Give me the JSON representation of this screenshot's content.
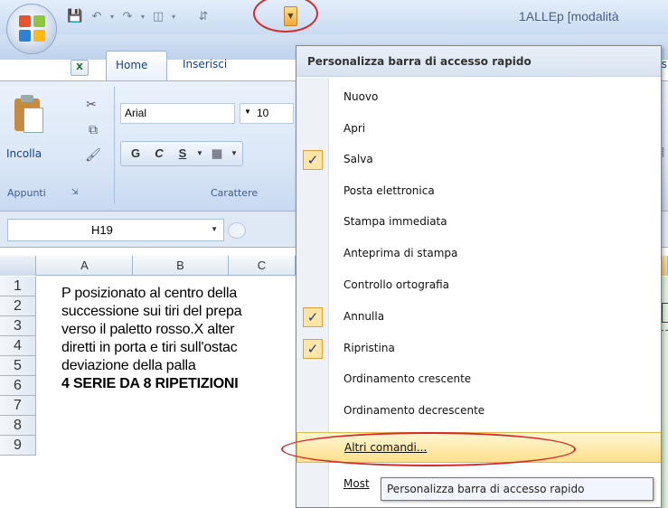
{
  "window": {
    "title": "1ALLEp  [modalità"
  },
  "quick_access": {
    "icons": [
      "save-icon",
      "undo-icon",
      "redo-icon",
      "print-preview-icon",
      "sort-icon",
      "customize-dropdown-icon"
    ]
  },
  "ribbon": {
    "tabs": [
      {
        "label": "Home"
      },
      {
        "label": "Inserisci"
      },
      {
        "label": "Revisi"
      }
    ],
    "clipboard": {
      "paste_label": "Incolla",
      "group_label": "Appunti"
    },
    "font": {
      "name": "Arial",
      "size": "10",
      "bold_label": "G",
      "italic_label": "C",
      "underline_label": "S",
      "group_label": "Carattere"
    }
  },
  "formula_bar": {
    "name_box": "H19"
  },
  "grid": {
    "columns": [
      "A",
      "B",
      "C"
    ],
    "rows": [
      "1",
      "2",
      "3",
      "4",
      "5",
      "6",
      "7",
      "8",
      "9"
    ],
    "cells": [
      "P posizionato al centro della",
      "successione sui tiri del prepa",
      "verso il paletto rosso.X alter",
      "diretti in porta e tiri sull'ostac",
      "deviazione della palla",
      "4 SERIE DA 8 RIPETIZIONI"
    ]
  },
  "menu": {
    "title": "Personalizza barra di accesso rapido",
    "items": [
      {
        "label": "Nuovo",
        "checked": false
      },
      {
        "label": "Apri",
        "checked": false
      },
      {
        "label": "Salva",
        "checked": true
      },
      {
        "label": "Posta elettronica",
        "checked": false
      },
      {
        "label": "Stampa immediata",
        "checked": false
      },
      {
        "label": "Anteprima di stampa",
        "checked": false
      },
      {
        "label": "Controllo ortografia",
        "checked": false
      },
      {
        "label": "Annulla",
        "checked": true
      },
      {
        "label": "Ripristina",
        "checked": true
      },
      {
        "label": "Ordinamento crescente",
        "checked": false
      },
      {
        "label": "Ordinamento decrescente",
        "checked": false
      },
      {
        "label": "Altri comandi...",
        "checked": false,
        "highlighted": true
      },
      {
        "label": "Most",
        "checked": false
      }
    ]
  },
  "tooltip": {
    "text": "Personalizza barra di accesso rapido"
  },
  "colors": {
    "highlight": "#fde08b",
    "annotation_red": "#d42a2a",
    "ribbon_blue": "#15428b"
  }
}
